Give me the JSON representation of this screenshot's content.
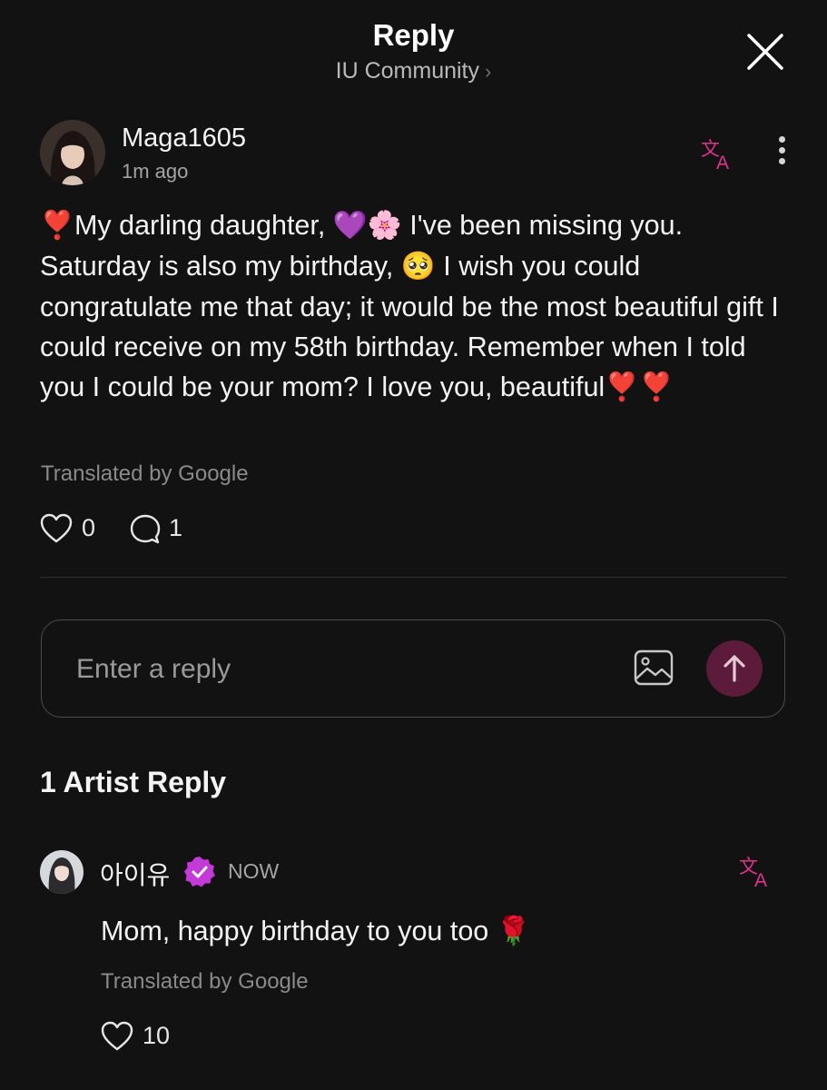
{
  "header": {
    "title": "Reply",
    "subtitle": "IU Community",
    "subtitle_chevron": "›",
    "close_icon": "close-icon"
  },
  "post": {
    "username": "Maga1605",
    "timestamp": "1m ago",
    "body": {
      "emoji_heart_1": "❣️",
      "seg1": "My darling daughter, ",
      "emoji_purple_heart": "💜",
      "emoji_blossom": "🌸",
      "seg2": " I've been missing you. Saturday is also my birthday, ",
      "emoji_pleading": "🥺",
      "seg3": " I wish you could congratulate me that day; it would be the most beautiful gift I could receive on my 58th birthday. Remember when I told you I could be your mom? I love you, beautiful",
      "emoji_heart_2": "❣️",
      "emoji_heart_3": "❣️"
    },
    "translated_by": "Translated by Google",
    "likes": "0",
    "comments": "1"
  },
  "reply_box": {
    "placeholder": "Enter a reply"
  },
  "artist_section": {
    "title": "1 Artist Reply",
    "reply": {
      "name": "아이유",
      "timestamp": "NOW",
      "body_text": "Mom, happy birthday to you too ",
      "body_emoji": "🌹",
      "translated_by": "Translated by Google",
      "likes": "10"
    }
  },
  "colors": {
    "background": "#121212",
    "accent_pink": "#e0338b",
    "verified_purple": "#c43ad8",
    "send_button": "#5c1b3a"
  }
}
